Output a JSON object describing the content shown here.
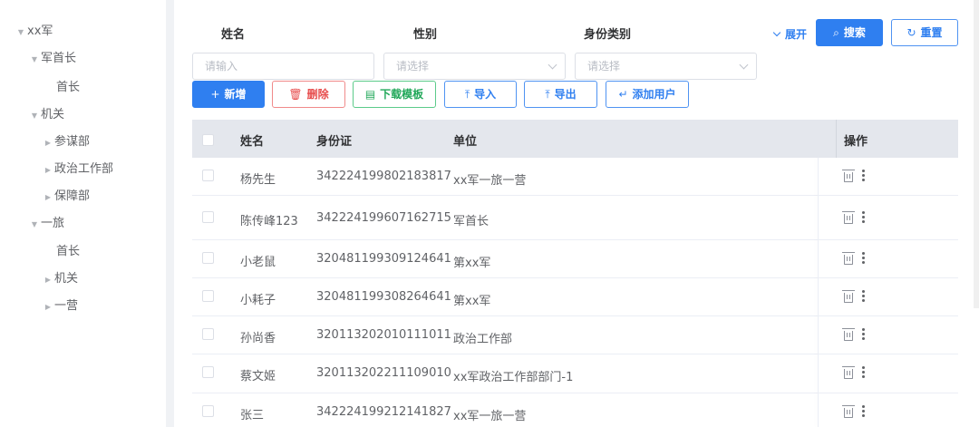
{
  "tree": [
    {
      "label": "xx军",
      "arrow": "down"
    },
    {
      "label": "军首长",
      "arrow": "down"
    },
    {
      "label": "首长",
      "arrow": "none"
    },
    {
      "label": "机关",
      "arrow": "down"
    },
    {
      "label": "参谋部",
      "arrow": "right"
    },
    {
      "label": "政治工作部",
      "arrow": "right"
    },
    {
      "label": "保障部",
      "arrow": "right"
    },
    {
      "label": "一旅",
      "arrow": "down"
    },
    {
      "label": "首长",
      "arrow": "none"
    },
    {
      "label": "机关",
      "arrow": "right"
    },
    {
      "label": "一营",
      "arrow": "right"
    }
  ],
  "filters": {
    "name_label": "姓名",
    "name_placeholder": "请输入",
    "gender_label": "性别",
    "gender_placeholder": "请选择",
    "idtype_label": "身份类别",
    "idtype_placeholder": "请选择",
    "expand": "展开",
    "search": "搜索",
    "reset": "重置"
  },
  "toolbar": {
    "add": "新增",
    "delete": "删除",
    "download_template": "下载模板",
    "import": "导入",
    "export": "导出",
    "add_user": "添加用户"
  },
  "table": {
    "columns": [
      "姓名",
      "身份证",
      "单位",
      "操作"
    ],
    "rows": [
      {
        "name": "杨先生",
        "id": "342224199802183817",
        "unit": "xx军一旅一营"
      },
      {
        "name": "陈传峰123",
        "id": "342224199607162715",
        "unit": "军首长"
      },
      {
        "name": "小老鼠",
        "id": "320481199309124641",
        "unit": "第xx军"
      },
      {
        "name": "小耗子",
        "id": "320481199308264641",
        "unit": "第xx军"
      },
      {
        "name": "孙尚香",
        "id": "320113202010111011",
        "unit": "政治工作部"
      },
      {
        "name": "蔡文姬",
        "id": "320113202211109010",
        "unit": "xx军政治工作部部门-1"
      },
      {
        "name": "张三",
        "id": "342224199212141827",
        "unit": "xx军一旅一营"
      }
    ]
  },
  "colors": {
    "primary": "#2f7ff0",
    "danger": "#e74c4c",
    "success": "#22a85a",
    "header_bg": "#e4e7ed"
  }
}
